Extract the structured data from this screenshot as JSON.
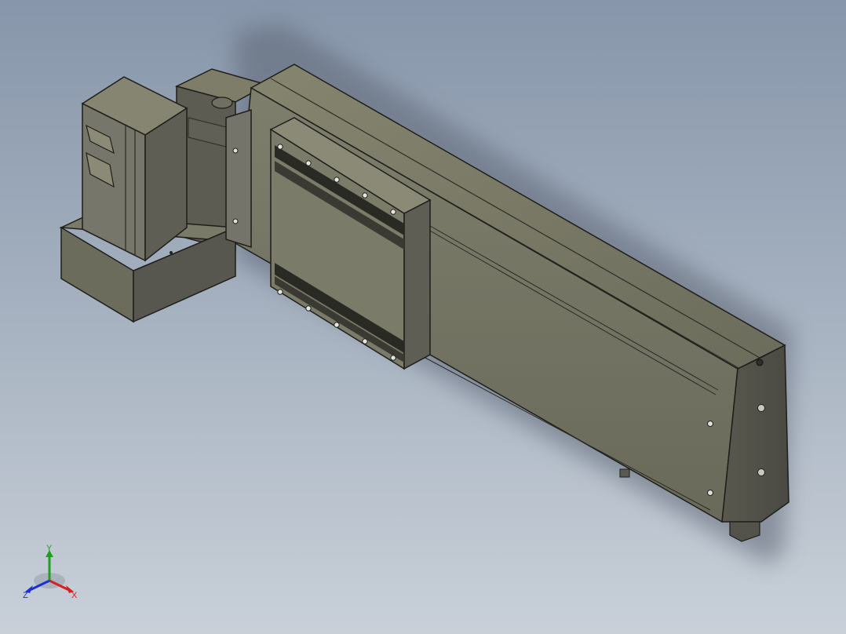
{
  "viewport": {
    "background_top": "#8796aa",
    "background_bottom": "#c9d0d8"
  },
  "model": {
    "body_color": "#6f6f62",
    "dark_face_color": "#505049",
    "edge_color": "#1e1e1a"
  },
  "triad": {
    "x_label": "X",
    "y_label": "Y",
    "z_label": "Z",
    "x_color": "#d42020",
    "y_color": "#1ea01e",
    "z_color": "#1e30d4"
  }
}
